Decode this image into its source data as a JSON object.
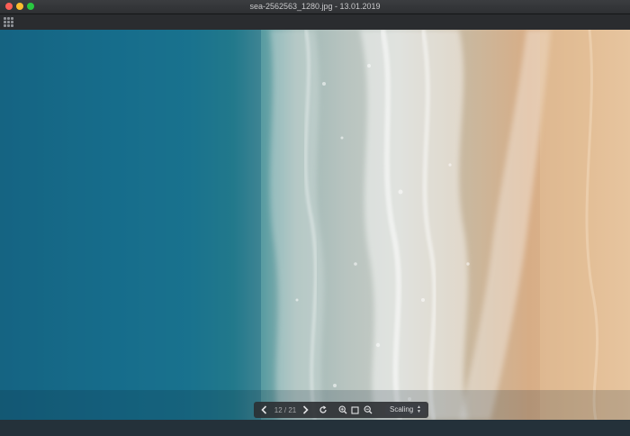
{
  "window": {
    "title": "sea-2562563_1280.jpg - 13.01.2019"
  },
  "toolbar": {
    "grid_icon": "grid-icon"
  },
  "viewer": {
    "image_description_icon": "photo",
    "counter": "12 / 21",
    "scaling_label": "Scaling"
  },
  "icons": {
    "prev": "chevron-left-icon",
    "next": "chevron-right-icon",
    "rotate": "rotate-icon",
    "zoom_in": "zoom-in-icon",
    "fit": "fit-window-icon",
    "zoom_out": "zoom-out-icon",
    "select_arrows": "select-arrows-icon"
  }
}
